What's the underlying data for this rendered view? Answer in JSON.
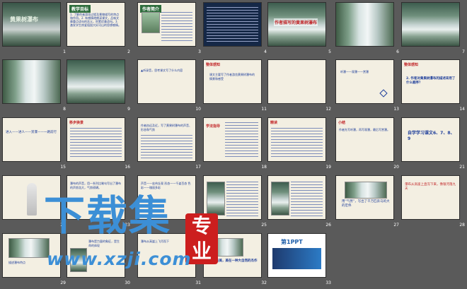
{
  "slides": [
    {
      "n": "1",
      "title": "黄果树瀑布"
    },
    {
      "n": "2",
      "heading": "教学目标",
      "lines": "1. 了解作者游览过程及景物描写的特点和作用。2. 有感情地朗读课文，品味文章重点语句的含义，积累优美语句。3. 激发学生热爱祖国大好河山的思想感情。"
    },
    {
      "n": "3",
      "heading": "作者简介"
    },
    {
      "n": "4"
    },
    {
      "n": "5",
      "heading": "作者描写的黄果树瀑布"
    },
    {
      "n": "6"
    },
    {
      "n": "7"
    },
    {
      "n": "8"
    },
    {
      "n": "9"
    },
    {
      "n": "10",
      "lines": "▲听录音，思考课文写了什么内容"
    },
    {
      "n": "11",
      "heading": "整体感知",
      "lines": "课文主要写了作者游览黄果树瀑布的情景和感受"
    },
    {
      "n": "12"
    },
    {
      "n": "13",
      "lines": "听瀑——观瀑——赏瀑"
    },
    {
      "n": "14",
      "heading": "整体感知",
      "lines": "2. 作者对黄果树瀑布的描述采用了什么顺序？"
    },
    {
      "n": "15",
      "lines": "进入——进人——赏瀑——一路前行"
    },
    {
      "n": "16",
      "heading": "移步换景"
    },
    {
      "n": "17",
      "lines": "作者由远及近，写了黄果树瀑布的声音、形态和气势"
    },
    {
      "n": "18",
      "heading": "学法指导"
    },
    {
      "n": "19",
      "heading": "精读"
    },
    {
      "n": "20",
      "heading": "小结",
      "lines": "作者先写听瀑，再写观瀑，最后写赏瀑。"
    },
    {
      "n": "21",
      "lines": "自学学习课文6、7、8、9"
    },
    {
      "n": "22"
    },
    {
      "n": "23",
      "lines": "瀑布的声音，用一系列比喻句写出了瀑布的声势浩大，气势磅礴。"
    },
    {
      "n": "24",
      "lines": "声音——宏伟壮观 形态——千姿百态 色彩——瑰丽多彩"
    },
    {
      "n": "25"
    },
    {
      "n": "26"
    },
    {
      "n": "27",
      "lines": "用“气势”，写出了千万匹奔马的大的宏伟"
    },
    {
      "n": "28",
      "lines": "瀑布从高崖上直泻下来，像银河落九天"
    },
    {
      "n": "29",
      "lines": "描述瀑布特点"
    },
    {
      "n": "30",
      "lines": "瀑布是力量的象征，是生命的体现"
    },
    {
      "n": "31",
      "lines": "瀑布从高崖上飞泻而下"
    },
    {
      "n": "32",
      "lines": "瀑布的美，美在一种大自然的杰作"
    },
    {
      "n": "33",
      "lines": "第1PPT"
    }
  ],
  "watermark": {
    "chinese": "下载集",
    "seal": "专业",
    "url": "www.xzji.com"
  }
}
